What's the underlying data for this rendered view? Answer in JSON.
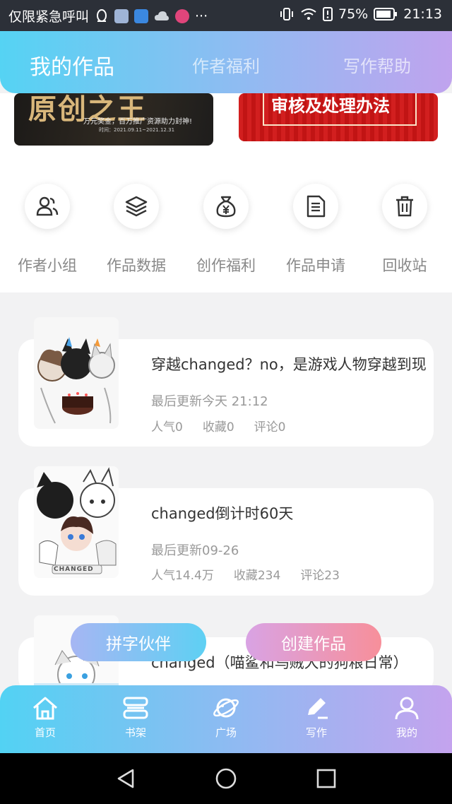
{
  "status_bar": {
    "carrier": "仅限紧急呼叫",
    "more": "···",
    "battery": "75%",
    "time": "21:13"
  },
  "header": {
    "tabs": [
      {
        "label": "我的作品",
        "active": true
      },
      {
        "label": "作者福利",
        "active": false
      },
      {
        "label": "写作帮助",
        "active": false
      }
    ]
  },
  "banners": {
    "left": {
      "headline": "原创之王",
      "sub": "万元奖金，百万推广资源助力封神!",
      "dates": "时间：2021.09.11~2021.12.31"
    },
    "right": {
      "headline": "审核及处理办法"
    }
  },
  "quick_entries": [
    {
      "label": "作者小组",
      "icon": "author-group-icon"
    },
    {
      "label": "作品数据",
      "icon": "layers-icon"
    },
    {
      "label": "创作福利",
      "icon": "money-bag-icon"
    },
    {
      "label": "作品申请",
      "icon": "document-icon"
    },
    {
      "label": "回收站",
      "icon": "trash-icon"
    }
  ],
  "works": [
    {
      "title": "穿越changed？no，是游戏人物穿越到现",
      "updated": "最后更新今天 21:12",
      "popularity": "人气0",
      "favorites": "收藏0",
      "comments": "评论0"
    },
    {
      "title": "changed倒计时60天",
      "updated": "最后更新09-26",
      "popularity": "人气14.4万",
      "favorites": "收藏234",
      "comments": "评论23"
    },
    {
      "title": "changed（喵鲨和乌贼大的狗粮日常）"
    }
  ],
  "cover_caption": "CHANGED",
  "floating_buttons": {
    "partner": "拼字伙伴",
    "create": "创建作品"
  },
  "bottom_nav": [
    {
      "label": "首页",
      "icon": "home-icon"
    },
    {
      "label": "书架",
      "icon": "bookshelf-icon"
    },
    {
      "label": "广场",
      "icon": "planet-icon"
    },
    {
      "label": "写作",
      "icon": "pen-icon"
    },
    {
      "label": "我的",
      "icon": "user-icon"
    }
  ],
  "colors": {
    "accent_blue": "#55d3f3",
    "accent_purple": "#c0a3ee",
    "create_pink": "#f78f9a"
  }
}
